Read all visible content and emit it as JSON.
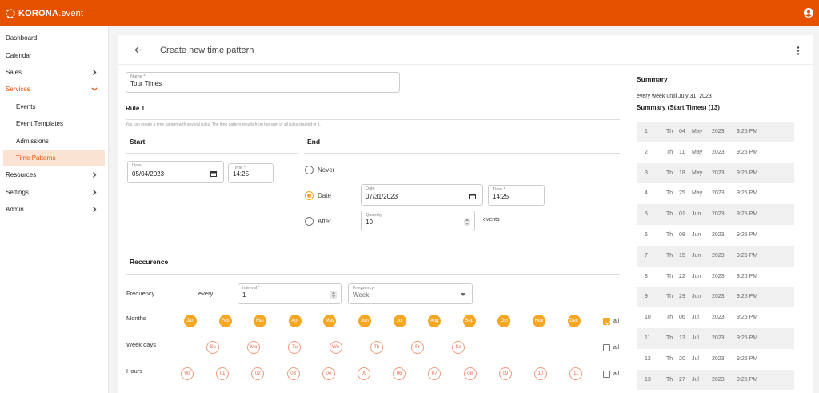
{
  "app": {
    "logo_text": "KORONA",
    "logo_suffix": ".event",
    "colors": {
      "brand": "#e65100",
      "accent": "#f5a623"
    }
  },
  "sidebar": {
    "items": [
      {
        "label": "Dashboard",
        "chevron": false,
        "state": "normal",
        "level": 0
      },
      {
        "label": "Calendar",
        "chevron": false,
        "state": "normal",
        "level": 0
      },
      {
        "label": "Sales",
        "chevron": "right",
        "state": "normal",
        "level": 0
      },
      {
        "label": "Services",
        "chevron": "down",
        "state": "active",
        "level": 0
      },
      {
        "label": "Events",
        "chevron": false,
        "state": "normal",
        "level": 1
      },
      {
        "label": "Event Templates",
        "chevron": false,
        "state": "normal",
        "level": 1
      },
      {
        "label": "Admissions",
        "chevron": false,
        "state": "normal",
        "level": 1
      },
      {
        "label": "Time Patterns",
        "chevron": false,
        "state": "selected",
        "level": 1
      },
      {
        "label": "Resources",
        "chevron": "right",
        "state": "normal",
        "level": 0
      },
      {
        "label": "Settings",
        "chevron": "right",
        "state": "normal",
        "level": 0
      },
      {
        "label": "Admin",
        "chevron": "right",
        "state": "normal",
        "level": 0
      }
    ]
  },
  "page": {
    "title": "Create new time pattern"
  },
  "form": {
    "name": {
      "label": "Name *",
      "value": "Tour Times"
    },
    "rule_title": "Rule 1",
    "rule_hint": "You can create a time pattern with several rules. The time pattern results from the sum of all rules created in it.",
    "start": {
      "title": "Start",
      "date": {
        "label": "Date",
        "value": "05/04/2023"
      },
      "time": {
        "label": "Time *",
        "value": "14:25"
      }
    },
    "end": {
      "title": "End",
      "never_label": "Never",
      "date_label": "Date",
      "after_label": "After",
      "selected": "Date",
      "date": {
        "label": "Date",
        "value": "07/31/2023"
      },
      "time": {
        "label": "Time *",
        "value": "14:25"
      },
      "quantity": {
        "label": "Quantity",
        "value": "10"
      },
      "events_label": "events"
    },
    "recurrence": {
      "title": "Reccurence",
      "frequency_label": "Frequency",
      "every_label": "every",
      "interval": {
        "label": "Interval *",
        "value": "1"
      },
      "frequency": {
        "label": "Frequency",
        "value": "Week"
      },
      "months_label": "Months",
      "months": [
        "Jan",
        "Feb",
        "Mar",
        "Apr",
        "May",
        "Jun",
        "Jul",
        "Aug",
        "Sep",
        "Oct",
        "Nov",
        "Dec"
      ],
      "months_all": {
        "label": "all",
        "checked": true
      },
      "weekdays_label": "Week days",
      "weekdays": [
        "Su",
        "Mo",
        "Tu",
        "We",
        "Th",
        "Fr",
        "Sa"
      ],
      "weekdays_all": {
        "label": "all",
        "checked": false
      },
      "hours_label": "Hours",
      "hours": [
        "00",
        "01",
        "02",
        "03",
        "04",
        "05",
        "06",
        "07",
        "08",
        "09",
        "10",
        "11"
      ],
      "hours_all": {
        "label": "all",
        "checked": false
      }
    }
  },
  "summary": {
    "title": "Summary",
    "text": "every week until July 31, 2023",
    "start_times_title": "Summary (Start Times) (13)",
    "rows": [
      {
        "n": "1",
        "wd": "Th",
        "d": "04",
        "m": "May",
        "y": "2023",
        "t": "9:25 PM"
      },
      {
        "n": "2",
        "wd": "Th",
        "d": "11",
        "m": "May",
        "y": "2023",
        "t": "9:25 PM"
      },
      {
        "n": "3",
        "wd": "Th",
        "d": "18",
        "m": "May",
        "y": "2023",
        "t": "9:25 PM"
      },
      {
        "n": "4",
        "wd": "Th",
        "d": "25",
        "m": "May",
        "y": "2023",
        "t": "9:25 PM"
      },
      {
        "n": "5",
        "wd": "Th",
        "d": "01",
        "m": "Jun",
        "y": "2023",
        "t": "9:25 PM"
      },
      {
        "n": "6",
        "wd": "Th",
        "d": "08",
        "m": "Jun",
        "y": "2023",
        "t": "9:25 PM"
      },
      {
        "n": "7",
        "wd": "Th",
        "d": "15",
        "m": "Jun",
        "y": "2023",
        "t": "9:25 PM"
      },
      {
        "n": "8",
        "wd": "Th",
        "d": "22",
        "m": "Jun",
        "y": "2023",
        "t": "9:25 PM"
      },
      {
        "n": "9",
        "wd": "Th",
        "d": "29",
        "m": "Jun",
        "y": "2023",
        "t": "9:25 PM"
      },
      {
        "n": "10",
        "wd": "Th",
        "d": "06",
        "m": "Jul",
        "y": "2023",
        "t": "9:25 PM"
      },
      {
        "n": "11",
        "wd": "Th",
        "d": "13",
        "m": "Jul",
        "y": "2023",
        "t": "9:25 PM"
      },
      {
        "n": "12",
        "wd": "Th",
        "d": "20",
        "m": "Jul",
        "y": "2023",
        "t": "9:25 PM"
      },
      {
        "n": "13",
        "wd": "Th",
        "d": "27",
        "m": "Jul",
        "y": "2023",
        "t": "9:25 PM"
      }
    ]
  }
}
